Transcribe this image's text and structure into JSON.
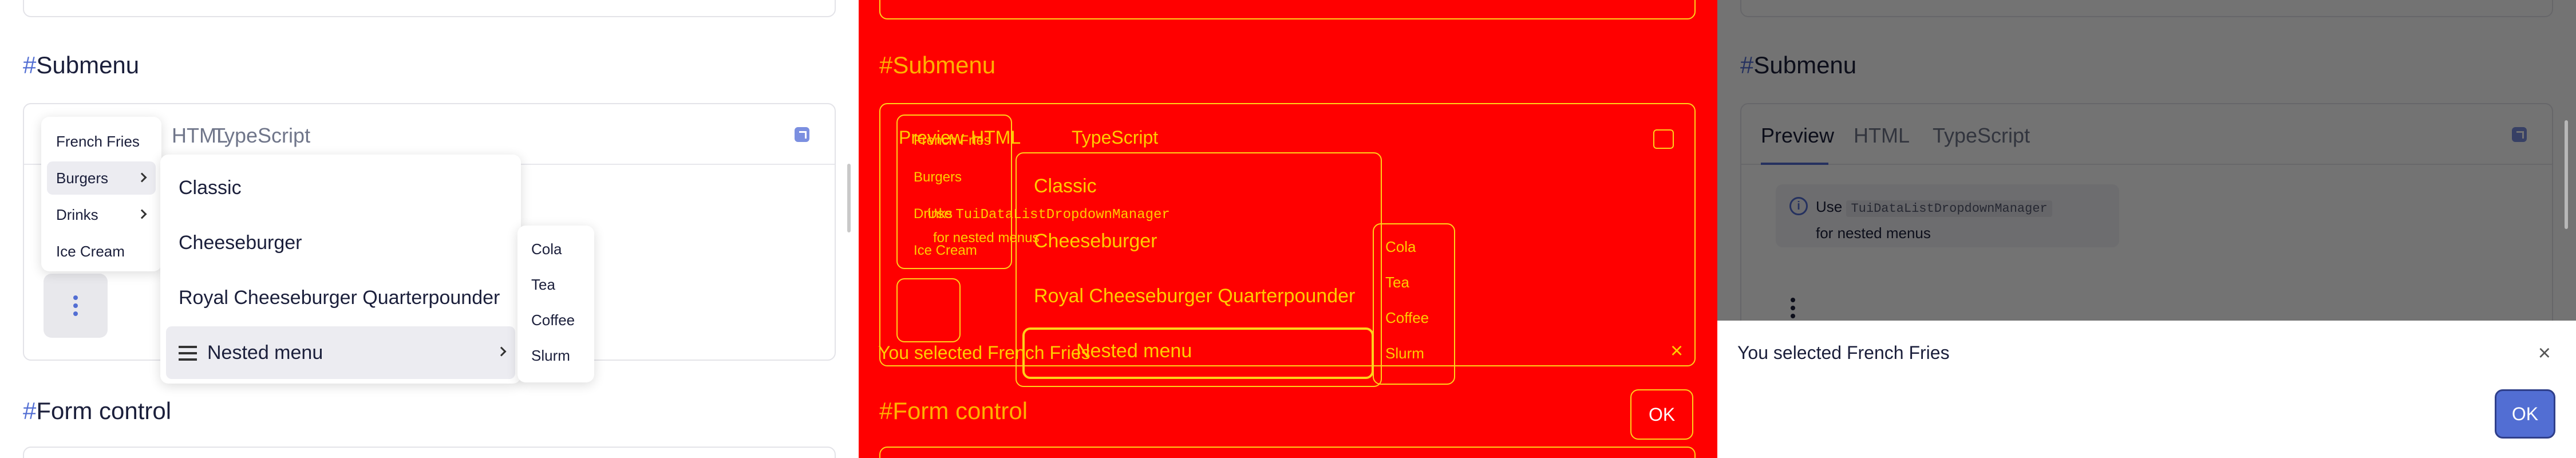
{
  "headings": {
    "submenu": "Submenu",
    "form_control": "Form control",
    "hash": "#"
  },
  "tabs": [
    "Preview",
    "HTML",
    "TypeScript"
  ],
  "hint": {
    "prefix": "Use",
    "code": "TuiDataListDropdownManager",
    "suffix": "for nested menus"
  },
  "menu_level1": [
    {
      "label": "French Fries"
    },
    {
      "label": "Burgers"
    },
    {
      "label": "Drinks"
    },
    {
      "label": "Ice Cream"
    }
  ],
  "menu_burgers": [
    {
      "label": "Classic"
    },
    {
      "label": "Cheeseburger"
    },
    {
      "label": "Royal Cheeseburger Quarterpounder"
    },
    {
      "label": "Nested menu"
    }
  ],
  "menu_drinks": [
    {
      "label": "Cola"
    },
    {
      "label": "Tea"
    },
    {
      "label": "Coffee"
    },
    {
      "label": "Slurm"
    }
  ],
  "notification": {
    "message": "You selected French Fries",
    "ok_label": "OK",
    "close_glyph": "×"
  },
  "icons": {
    "info": "i"
  },
  "colors": {
    "accent": "#526ed3",
    "overlay_red": "#ff0000",
    "overlay_outline": "#ffd11a"
  }
}
